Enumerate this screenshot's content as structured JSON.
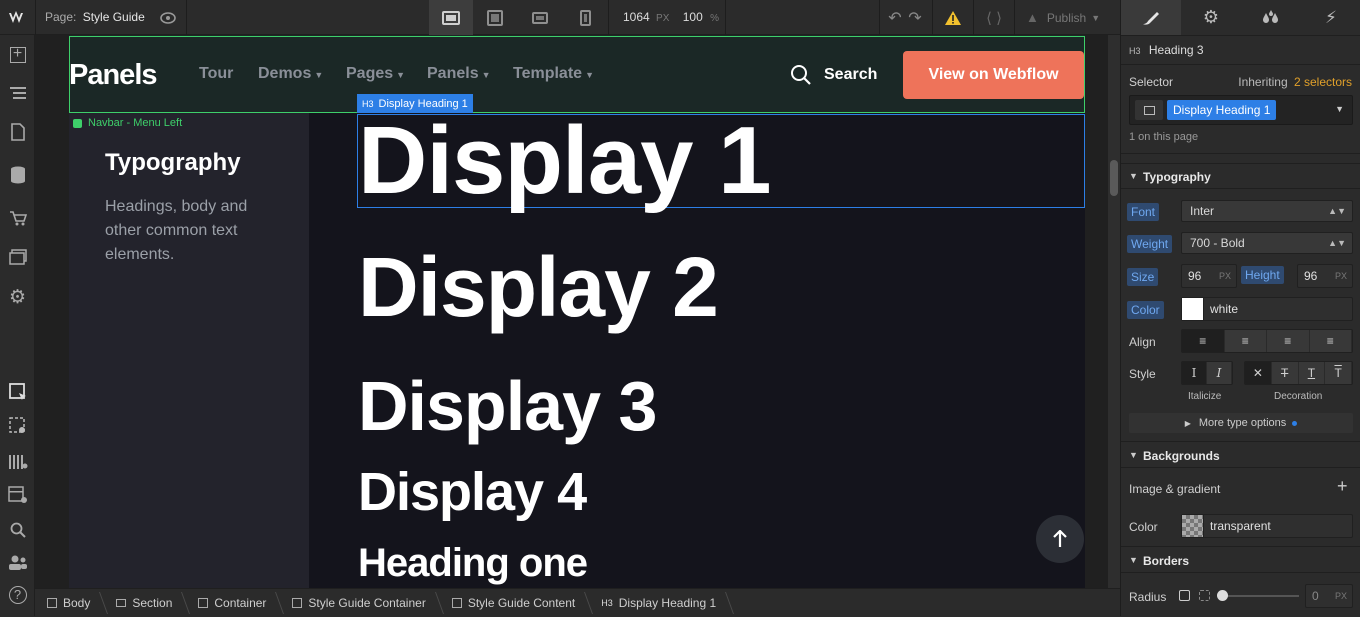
{
  "topbar": {
    "page_label": "Page:",
    "page_name": "Style Guide",
    "canvas_width": "1064",
    "width_unit": "PX",
    "zoom": "100",
    "zoom_unit": "%",
    "publish_label": "Publish"
  },
  "navbar": {
    "brand": "Panels",
    "links": [
      "Tour",
      "Demos",
      "Pages",
      "Panels",
      "Template"
    ],
    "search_label": "Search",
    "cta_label": "View on Webflow",
    "cta_color": "#ee735a",
    "selection_label": "Navbar - Menu Left"
  },
  "sidebar": {
    "title": "Typography",
    "description": "Headings, body and other common text elements."
  },
  "content": {
    "selected_tag": "H3",
    "selected_label": "Display Heading 1",
    "headings": [
      "Display 1",
      "Display 2",
      "Display 3",
      "Display 4",
      "Heading one"
    ]
  },
  "right_panel": {
    "element_tag": "H3",
    "element_name": "Heading 3",
    "selector_label": "Selector",
    "inheriting_label": "Inheriting",
    "inheriting_count": "2 selectors",
    "selector_chip": "Display Heading 1",
    "on_page": "1 on this page",
    "typography_title": "Typography",
    "font_label": "Font",
    "font_value": "Inter",
    "weight_label": "Weight",
    "weight_value": "700 - Bold",
    "size_label": "Size",
    "size_value": "96",
    "size_unit": "PX",
    "height_label": "Height",
    "height_value": "96",
    "height_unit": "PX",
    "color_label": "Color",
    "color_value": "white",
    "align_label": "Align",
    "style_label": "Style",
    "italicize_label": "Italicize",
    "decoration_label": "Decoration",
    "more_options": "More type options",
    "backgrounds_title": "Backgrounds",
    "image_gradient_label": "Image & gradient",
    "bg_color_label": "Color",
    "bg_color_value": "transparent",
    "borders_title": "Borders",
    "radius_label": "Radius",
    "radius_value": "0",
    "radius_unit": "PX"
  },
  "breadcrumb": [
    "Body",
    "Section",
    "Container",
    "Style Guide Container",
    "Style Guide Content",
    "Display Heading 1"
  ],
  "breadcrumb_last_tag": "H3",
  "colors": {
    "accent_blue": "#2d7fe6",
    "selection_green": "#3ecf6a",
    "page_bg": "#14141c"
  }
}
